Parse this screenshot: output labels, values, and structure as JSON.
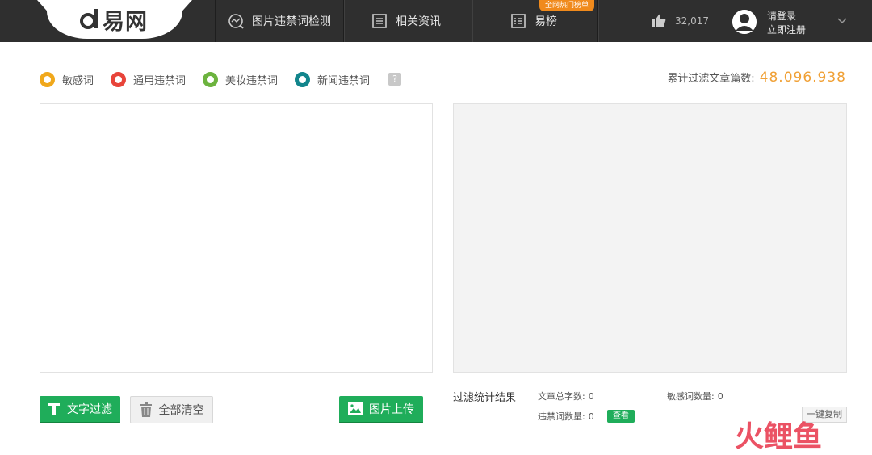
{
  "header": {
    "logo_text": "易网",
    "nav": [
      {
        "label": "图片违禁词检测",
        "icon": "image-scan-icon"
      },
      {
        "label": "相关资讯",
        "icon": "news-icon"
      },
      {
        "label": "易榜",
        "icon": "list-icon",
        "badge": "全网热门榜单"
      }
    ],
    "likes": "32,017",
    "login": "请登录",
    "register": "立即注册"
  },
  "legend": {
    "items": [
      {
        "label": "敏感词",
        "color": "#f0a81c"
      },
      {
        "label": "通用违禁词",
        "color": "#e8443a"
      },
      {
        "label": "美妆违禁词",
        "color": "#6cb33e"
      },
      {
        "label": "新闻违禁词",
        "color": "#12858c"
      }
    ],
    "help": "?"
  },
  "counter": {
    "label": "累计过滤文章篇数:",
    "value": "48.096.938"
  },
  "input": {
    "value": "",
    "placeholder": ""
  },
  "buttons": {
    "filter": "文字过滤",
    "clear": "全部清空",
    "upload": "图片上传"
  },
  "stats": {
    "title": "过滤统计结果",
    "total_chars_label": "文章总字数:",
    "total_chars": "0",
    "sensitive_label": "敏感词数量:",
    "sensitive": "0",
    "banned_label": "违禁词数量:",
    "banned": "0",
    "view": "查看",
    "copy": "一键复制"
  },
  "watermark": "火鲤鱼"
}
